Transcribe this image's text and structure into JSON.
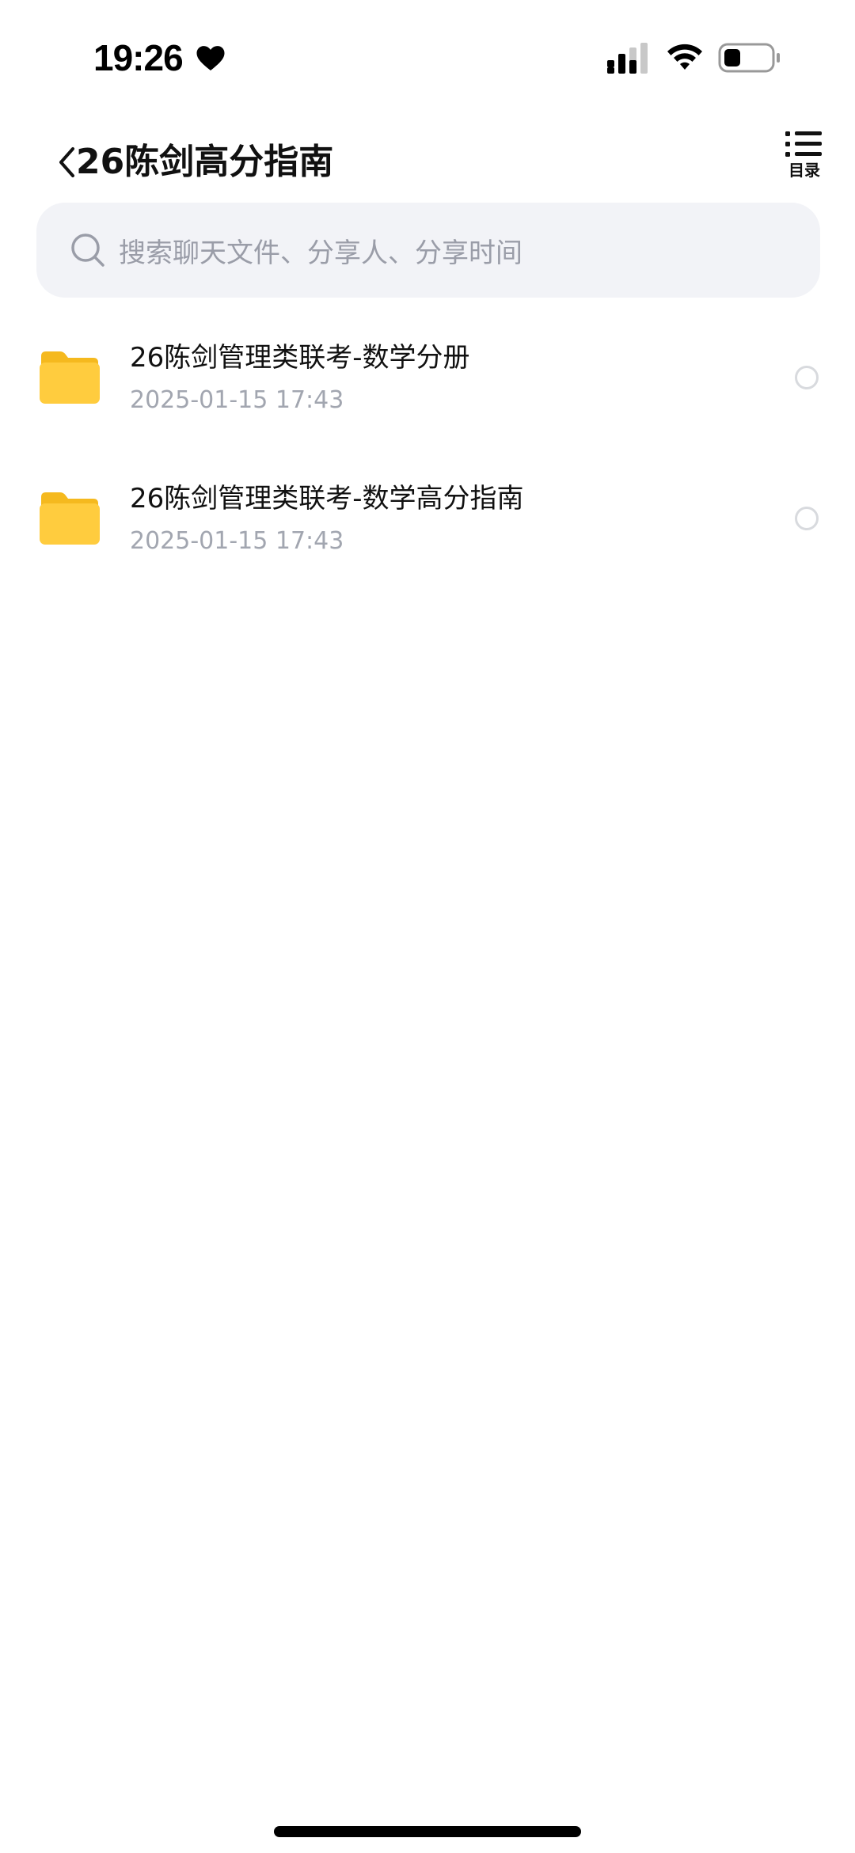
{
  "status_bar": {
    "time": "19:26",
    "icons": [
      "heart-icon",
      "signal-icon",
      "wifi-icon",
      "battery-icon"
    ]
  },
  "header": {
    "back_icon": "chevron-left-icon",
    "title": "26陈剑高分指南",
    "toc_icon": "list-icon",
    "toc_label": "目录"
  },
  "search": {
    "icon": "search-icon",
    "placeholder": "搜索聊天文件、分享人、分享时间"
  },
  "files": [
    {
      "icon": "folder-icon",
      "name": "26陈剑管理类联考-数学分册",
      "date": "2025-01-15 17:43",
      "selected": false
    },
    {
      "icon": "folder-icon",
      "name": "26陈剑管理类联考-数学高分指南",
      "date": "2025-01-15 17:43",
      "selected": false
    }
  ],
  "colors": {
    "folder_yellow": "#FFC93C",
    "search_background": "#F2F3F7",
    "secondary_text": "#A2A6B0",
    "radio_border": "#D8DADE"
  }
}
